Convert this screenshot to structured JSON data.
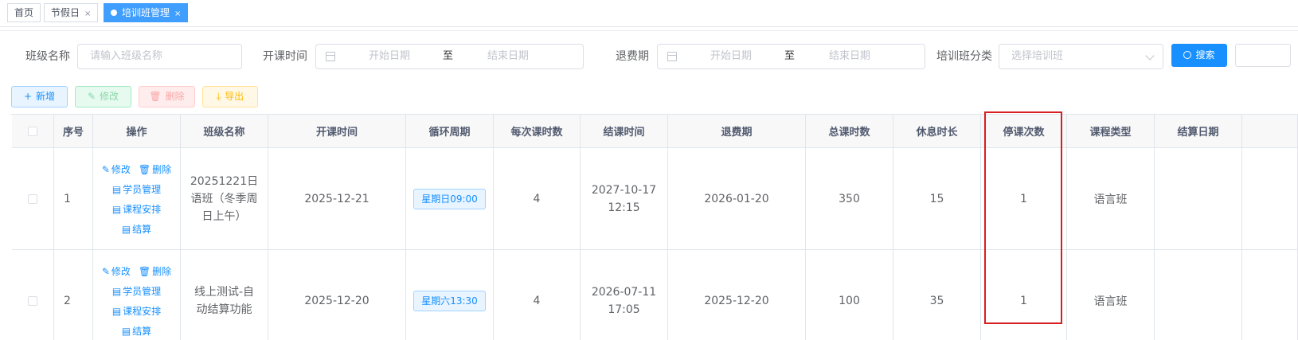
{
  "tags": [
    {
      "label": "首页",
      "closable": false,
      "active": false
    },
    {
      "label": "节假日",
      "closable": true,
      "active": false
    },
    {
      "label": "培训班管理",
      "closable": true,
      "active": true
    }
  ],
  "tag_close_glyph": "×",
  "search": {
    "class_name_label": "班级名称",
    "class_name_placeholder": "请输入班级名称",
    "open_time_label": "开课时间",
    "open_start_placeholder": "开始日期",
    "open_range_sep": "至",
    "open_end_placeholder": "结束日期",
    "refund_label": "退费期",
    "refund_start_placeholder": "开始日期",
    "refund_range_sep": "至",
    "refund_end_placeholder": "结束日期",
    "category_label": "培训班分类",
    "category_placeholder": "选择培训班",
    "search_button": "搜索"
  },
  "toolbar": {
    "add": "新增",
    "edit": "修改",
    "delete": "删除",
    "export": "导出"
  },
  "table": {
    "columns": [
      "序号",
      "操作",
      "班级名称",
      "开课时间",
      "循环周期",
      "每次课时数",
      "结课时间",
      "退费期",
      "总课时数",
      "休息时长",
      "停课次数",
      "课程类型",
      "结算日期"
    ],
    "row_actions": {
      "edit": "修改",
      "delete": "删除",
      "students": "学员管理",
      "schedule": "课程安排",
      "settle": "结算"
    },
    "rows": [
      {
        "index": "1",
        "class_name": "20251221日语班（冬季周日上午）",
        "start_time": "2025-12-21",
        "cycle": "星期日09:00",
        "hours_per_class": "4",
        "end_time": "2027-10-17 12:15",
        "refund_period": "2026-01-20",
        "total_hours": "350",
        "rest_duration": "15",
        "suspend_count": "1",
        "course_type": "语言班",
        "settle_date": ""
      },
      {
        "index": "2",
        "class_name": "线上测试-自动结算功能",
        "start_time": "2025-12-20",
        "cycle": "星期六13:30",
        "hours_per_class": "4",
        "end_time": "2026-07-11 17:05",
        "refund_period": "2025-12-20",
        "total_hours": "100",
        "rest_duration": "35",
        "suspend_count": "1",
        "course_type": "语言班",
        "settle_date": ""
      }
    ]
  },
  "highlighted_column": "停课次数",
  "colors": {
    "primary": "#1890ff",
    "highlight_border": "#d81e1e"
  }
}
